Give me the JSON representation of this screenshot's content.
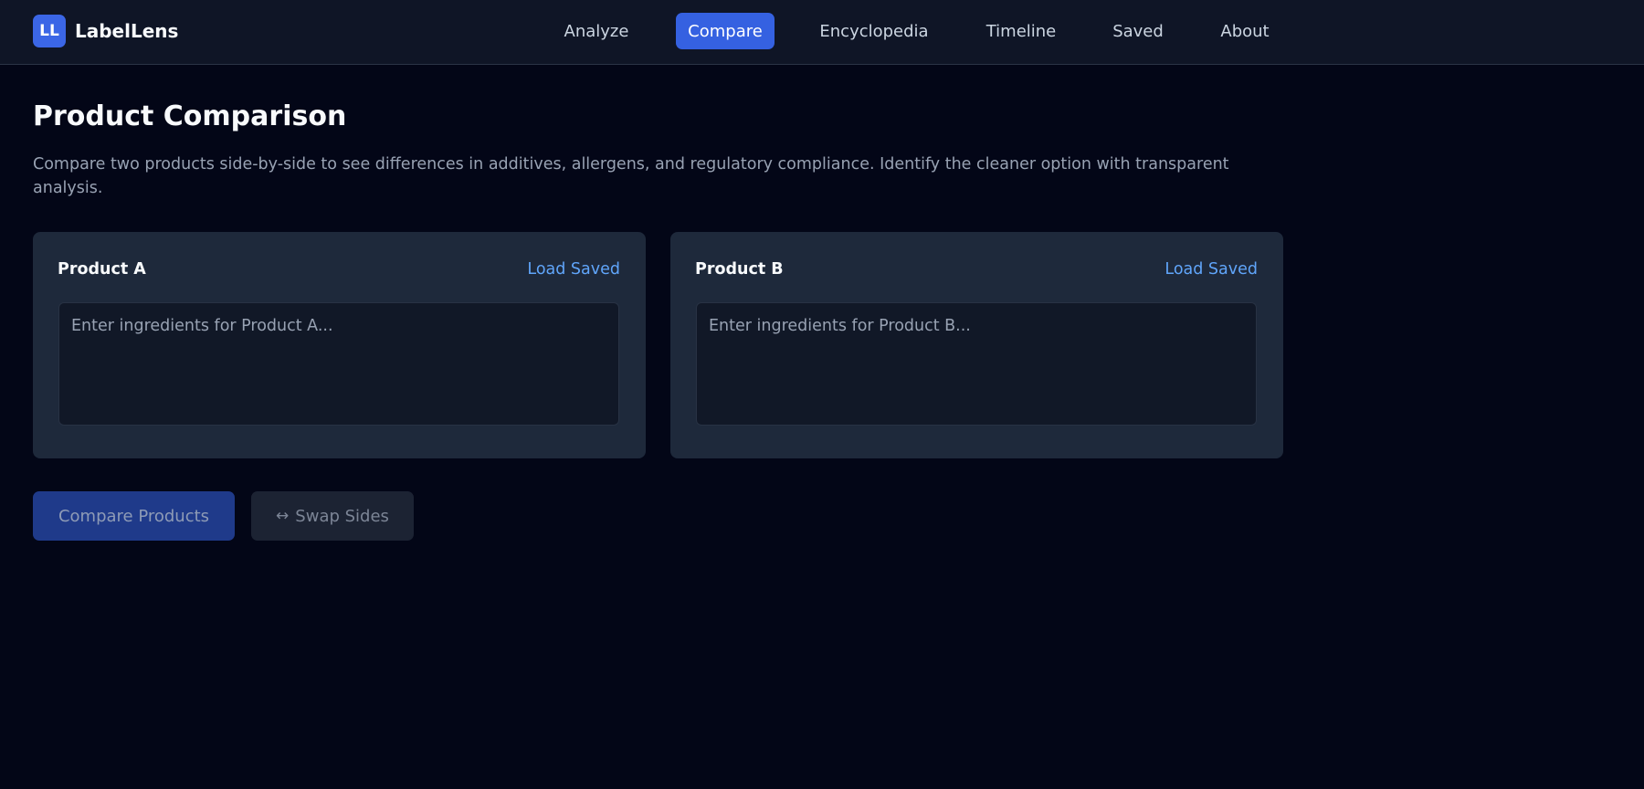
{
  "app": {
    "logo_text": "LL",
    "name": "LabelLens"
  },
  "nav": {
    "items": [
      {
        "label": "Analyze",
        "active": false
      },
      {
        "label": "Compare",
        "active": true
      },
      {
        "label": "Encyclopedia",
        "active": false
      },
      {
        "label": "Timeline",
        "active": false
      },
      {
        "label": "Saved",
        "active": false
      },
      {
        "label": "About",
        "active": false
      }
    ]
  },
  "page": {
    "title": "Product Comparison",
    "description": "Compare two products side-by-side to see differences in additives, allergens, and regulatory compliance. Identify the cleaner option with transparent analysis."
  },
  "products": [
    {
      "title": "Product A",
      "load_label": "Load Saved",
      "value": "",
      "placeholder": "Enter ingredients for Product A..."
    },
    {
      "title": "Product B",
      "load_label": "Load Saved",
      "value": "",
      "placeholder": "Enter ingredients for Product B..."
    }
  ],
  "actions": {
    "compare_label": "Compare Products",
    "swap_icon": "↔",
    "swap_label": "Swap Sides"
  },
  "colors": {
    "background": "#030617",
    "header": "#0f1526",
    "accent": "#3561e1",
    "panel": "#1e293b",
    "link": "#60a5fa"
  }
}
